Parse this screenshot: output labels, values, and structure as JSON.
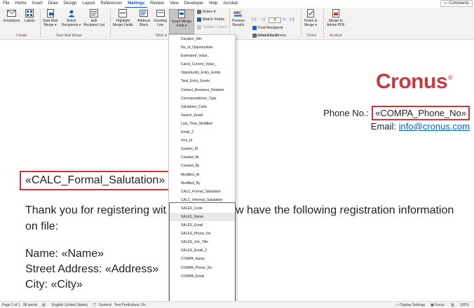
{
  "tabs": [
    "File",
    "Home",
    "Insert",
    "Draw",
    "Design",
    "Layout",
    "References",
    "Mailings",
    "Review",
    "View",
    "Developer",
    "Help",
    "Acrobat"
  ],
  "active_tab": "Mailings",
  "comments_label": "Comments",
  "ribbon": {
    "envelopes": "Envelopes",
    "labels": "Labels",
    "group_create": "Create",
    "start_mail_merge": [
      "Start Mail",
      "Merge ▾"
    ],
    "select_recipients": [
      "Select",
      "Recipients ▾"
    ],
    "edit_recipient_list": [
      "Edit",
      "Recipient List"
    ],
    "group_start": "Start Mail Merge",
    "highlight_merge_fields": [
      "Highlight",
      "Merge Fields"
    ],
    "address_block": [
      "Address",
      "Block"
    ],
    "greeting_line": [
      "Greeting",
      "Line"
    ],
    "insert_merge_field": [
      "Insert Merge",
      "Field ▾"
    ],
    "rules": "Rules ▾",
    "match_fields": "Match Fields",
    "update_labels": "Update Labels",
    "group_write": "Write & Ins",
    "preview_results": [
      "Preview",
      "Results"
    ],
    "record_number": "0",
    "find_recipient": "Find Recipient",
    "check_for_errors": "Check for Errors",
    "group_preview": "Preview Results",
    "finish_merge": [
      "Finish &",
      "Merge ▾"
    ],
    "group_finish": "Finish",
    "merge_to_pdf": [
      "Merge to",
      "Adobe PDF"
    ],
    "group_acrobat": "Acrobat"
  },
  "dropdown_fields": [
    "Duration_Min",
    "No_of_Opportunities",
    "Estimated_Value_",
    "Calcd_Current_Value_",
    "Opportunity_Entry_Exists",
    "Task_Entry_Exists",
    "Contact_Business_Relation",
    "Correspondence_Type",
    "Salutation_Code",
    "Search_Email",
    "Last_Time_Modified",
    "Email_2",
    "Xrm_Id",
    "System_ID",
    "Created_At",
    "Created_By",
    "Modified_At",
    "Modified_By",
    "CALC_Formal_Salutation",
    "CALC_Informal_Salutation",
    "SALES_Code",
    "SALES_Name",
    "SALES_Email",
    "SALES_Phone_No",
    "SALES_Job_Title",
    "SALES_Email_2",
    "COMPA_Name",
    "COMPA_Phone_No",
    "COMPA_Email"
  ],
  "document": {
    "logo": "Cronus",
    "logo_mark": "®",
    "phone_label": "Phone No.:",
    "phone_field": "«COMPA_Phone_No»",
    "email_label": "Email:",
    "email_value": "info@cronus.com",
    "salutation": "«CALC_Formal_Salutation»",
    "para_line1_a": "Thank you for registering wit",
    "para_line1_b": "w have the following registration information",
    "para_line2": "on file:",
    "name_line": "Name: «Name»",
    "street_line": "Street Address: «Address»",
    "city_line": "City: «City»"
  },
  "status": {
    "page": "Page 1 of 1",
    "words": "98 words",
    "language": "English (United States)",
    "general": "General",
    "text_predictions": "Text Predictions: On",
    "display_settings": "Display Settings",
    "focus": "Focus",
    "zoom": "100%"
  },
  "colors": {
    "accent": "#185abd",
    "highlight_red": "#d13438",
    "logo_red": "#c43a3f",
    "link": "#0563c1"
  }
}
